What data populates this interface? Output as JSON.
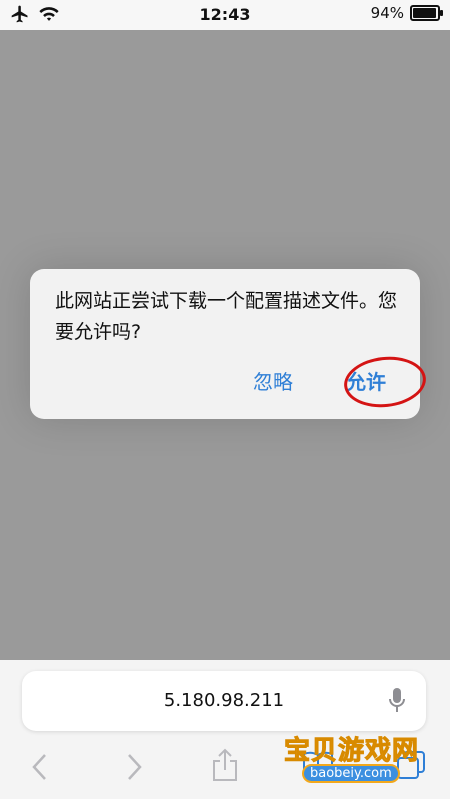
{
  "status_bar": {
    "time": "12:43",
    "battery_percent": "94%",
    "battery_level": 0.94
  },
  "dialog": {
    "message": "此网站正尝试下载一个配置描述文件。您要允许吗?",
    "ignore_label": "忽略",
    "allow_label": "允许"
  },
  "browser": {
    "address": "5.180.98.211"
  },
  "watermark": {
    "title": "宝贝游戏网",
    "domain": "baobeiy.com"
  },
  "colors": {
    "accent": "#2f7fd6",
    "annotation_circle": "#d41414",
    "overlay": "#9a9a9a"
  },
  "icons": {
    "status": [
      "airplane-icon",
      "wifi-icon",
      "battery-icon"
    ],
    "toolbar": [
      "back-icon",
      "forward-icon",
      "share-icon",
      "bookmarks-icon",
      "tabs-icon"
    ],
    "address": "microphone-icon"
  }
}
